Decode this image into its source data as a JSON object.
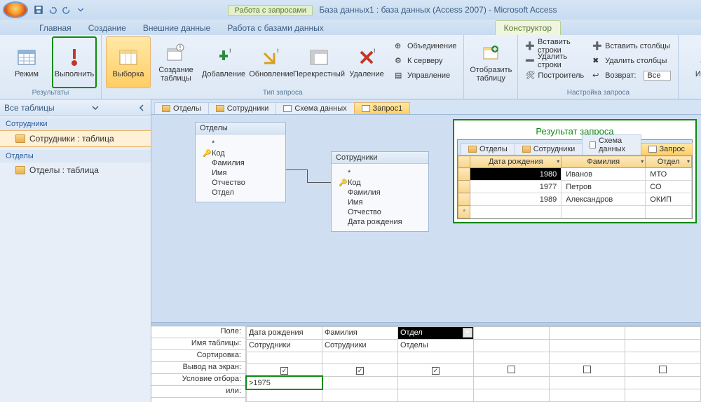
{
  "title": {
    "context_label": "Работа с запросами",
    "app_title": "База данных1 : база данных (Access 2007) - Microsoft Access"
  },
  "ribbon_tabs": [
    "Главная",
    "Создание",
    "Внешние данные",
    "Работа с базами данных"
  ],
  "context_tab": "Конструктор",
  "ribbon": {
    "group_results": "Результаты",
    "btn_mode": "Режим",
    "btn_run": "Выполнить",
    "group_querytype": "Тип запроса",
    "btn_select": "Выборка",
    "btn_maketable": "Создание таблицы",
    "btn_append": "Добавление",
    "btn_update": "Обновление",
    "btn_crosstab": "Перекрестный",
    "btn_delete": "Удаление",
    "btn_union": "Объединение",
    "btn_passthrough": "К серверу",
    "btn_datadef": "Управление",
    "group_showtable": "",
    "btn_showtable": "Отобразить таблицу",
    "group_querysetup": "Настройка запроса",
    "btn_insertrows": "Вставить строки",
    "btn_deleterows": "Удалить строки",
    "btn_builder": "Построитель",
    "btn_insertcols": "Вставить столбцы",
    "btn_deletecols": "Удалить столбцы",
    "lbl_return": "Возврат:",
    "val_return": "Все",
    "btn_totals": "Итоги"
  },
  "nav": {
    "header": "Все таблицы",
    "g1": "Сотрудники",
    "g1_item": "Сотрудники : таблица",
    "g2": "Отделы",
    "g2_item": "Отделы : таблица"
  },
  "doctabs": {
    "t1": "Отделы",
    "t2": "Сотрудники",
    "t3": "Схема данных",
    "t4": "Запрос1"
  },
  "design_tables": {
    "otdely": {
      "title": "Отделы",
      "fields": [
        "*",
        "Код",
        "Фамилия",
        "Имя",
        "Отчество",
        "Отдел"
      ],
      "key_index": 1
    },
    "sotrudniki": {
      "title": "Сотрудники",
      "fields": [
        "*",
        "Код",
        "Фамилия",
        "Имя",
        "Отчество",
        "Дата рождения"
      ],
      "key_index": 1
    }
  },
  "result": {
    "title": "Результат запроса",
    "cols": [
      "Дата рождения",
      "Фамилия",
      "Отдел"
    ],
    "rows": [
      {
        "y": "1980",
        "f": "Иванов",
        "o": "МТО"
      },
      {
        "y": "1977",
        "f": "Петров",
        "o": "СО"
      },
      {
        "y": "1989",
        "f": "Александров",
        "o": "ОКИП"
      }
    ],
    "tabs": [
      "Отделы",
      "Сотрудники",
      "Схема данных",
      "Запрос"
    ]
  },
  "qgrid": {
    "labels": [
      "Поле:",
      "Имя таблицы:",
      "Сортировка:",
      "Вывод на экран:",
      "Условие отбора:",
      "или:"
    ],
    "cols": [
      {
        "field": "Дата рождения",
        "table": "Сотрудники",
        "show": true,
        "criteria": ">1975",
        "hl": true
      },
      {
        "field": "Фамилия",
        "table": "Сотрудники",
        "show": true
      },
      {
        "field": "Отдел",
        "table": "Отделы",
        "show": true,
        "active": true
      }
    ]
  }
}
